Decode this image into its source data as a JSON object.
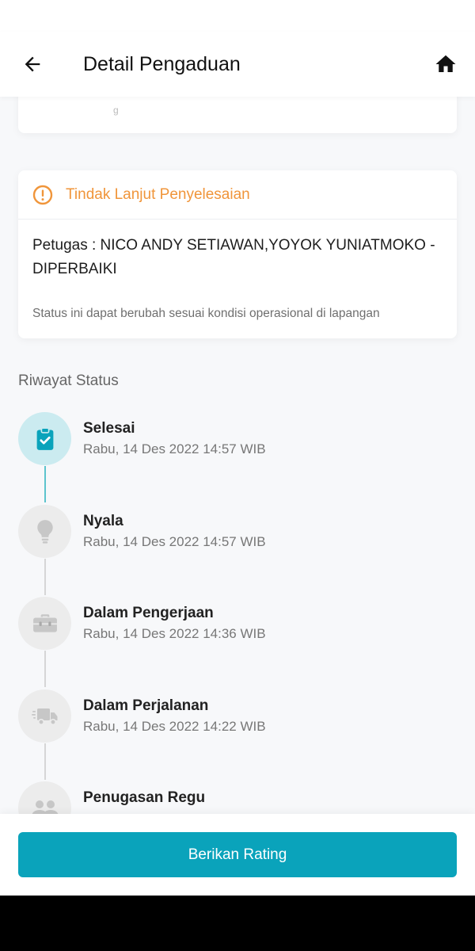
{
  "header": {
    "title": "Detail Pengaduan",
    "back_icon": "arrow-left-icon",
    "home_icon": "home-icon"
  },
  "followup": {
    "title": "Tindak Lanjut Penyelesaian",
    "officer": "Petugas : NICO ANDY SETIAWAN,YOYOK YUNIATMOKO - DIPERBAIKI",
    "note": "Status ini dapat berubah sesuai kondisi operasional di lapangan",
    "accent": "#f0953a"
  },
  "history": {
    "label": "Riwayat Status",
    "items": [
      {
        "title": "Selesai",
        "time": "Rabu, 14 Des 2022 14:57 WIB",
        "icon": "clipboard-check-icon"
      },
      {
        "title": "Nyala",
        "time": "Rabu, 14 Des 2022 14:57 WIB",
        "icon": "lightbulb-icon"
      },
      {
        "title": "Dalam Pengerjaan",
        "time": "Rabu, 14 Des 2022 14:36 WIB",
        "icon": "toolbox-icon"
      },
      {
        "title": "Dalam Perjalanan",
        "time": "Rabu, 14 Des 2022 14:22 WIB",
        "icon": "truck-icon"
      },
      {
        "title": "Penugasan Regu",
        "time": "",
        "icon": "users-icon"
      }
    ]
  },
  "actions": {
    "rate_label": "Berikan Rating",
    "button_color": "#0aa3bb"
  }
}
